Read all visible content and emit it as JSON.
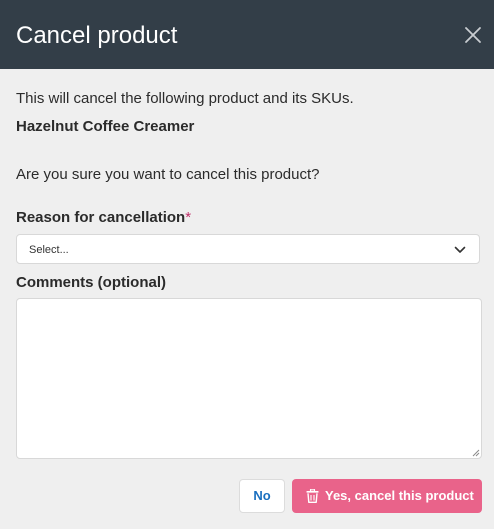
{
  "modal": {
    "title": "Cancel product"
  },
  "body": {
    "intro": "This will cancel the following product and its SKUs.",
    "product_name": "Hazelnut Coffee Creamer",
    "question": "Are you sure you want to cancel this product?"
  },
  "form": {
    "reason_label": "Reason for cancellation",
    "required_marker": "*",
    "reason_value": "Select...",
    "comments_label": "Comments (optional)",
    "comments_value": ""
  },
  "actions": {
    "no_label": "No",
    "yes_label": "Yes, cancel this product"
  },
  "icons": {
    "close": "close-icon",
    "dropdown": "chevron-down-icon",
    "delete": "trash-icon"
  },
  "colors": {
    "header_bg": "#333e48",
    "danger": "#e9638a",
    "link": "#1a6fbf",
    "required": "#c0306a"
  }
}
